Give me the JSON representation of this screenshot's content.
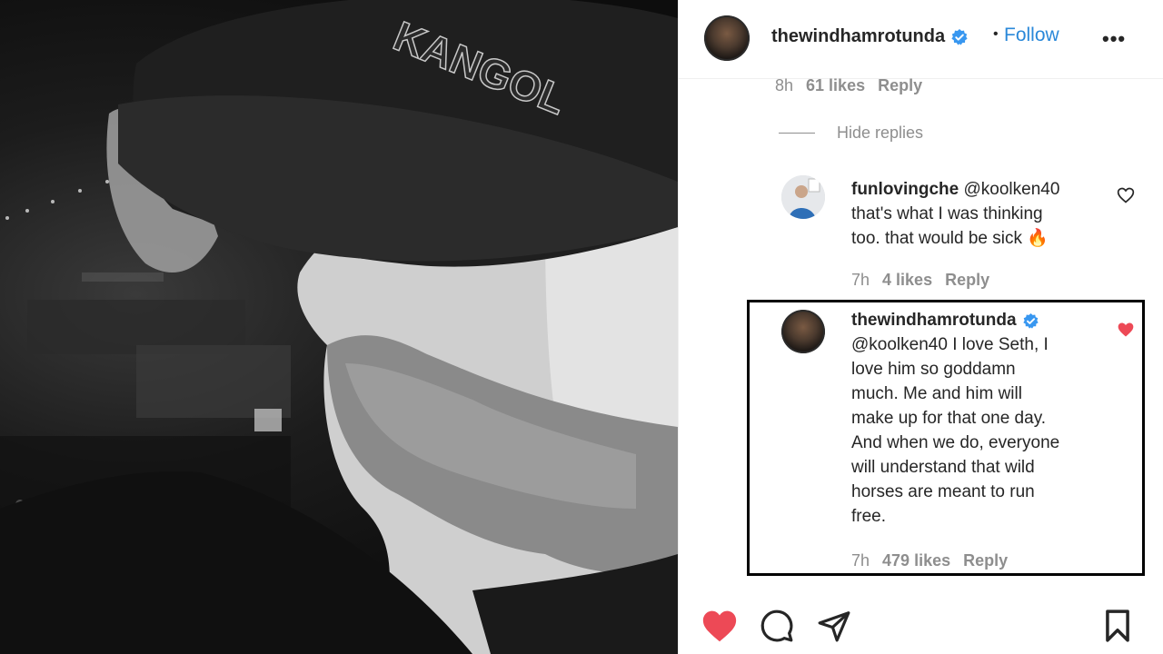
{
  "post": {
    "image_text": "KANGOL",
    "author": "thewindhamrotunda",
    "follow_label": "Follow",
    "separator": "•",
    "more_label": "•••"
  },
  "top_meta": {
    "time": "8h",
    "likes": "61 likes",
    "reply": "Reply"
  },
  "hide_replies": "Hide replies",
  "comments": [
    {
      "user": "funlovingche",
      "text_lines": [
        "@koolken40",
        "that's what I was thinking",
        "too. that would be sick 🔥"
      ],
      "time": "7h",
      "likes": "4 likes",
      "reply": "Reply",
      "liked": false
    },
    {
      "user": "thewindhamrotunda",
      "text_lines": [
        "@koolken40 I love Seth, I",
        "love him so goddamn",
        "much. Me and him will",
        "make up for that one day.",
        "And when we do, everyone",
        "will understand that wild",
        "horses are meant to run",
        "free."
      ],
      "time": "7h",
      "likes": "479 likes",
      "reply": "Reply",
      "liked": true
    }
  ],
  "icons": {
    "like": "heart-icon",
    "comment": "comment-icon",
    "share": "share-icon",
    "save": "bookmark-icon",
    "verified": "verified-badge-icon"
  },
  "colors": {
    "link": "#2a88d9",
    "verified": "#3897f0",
    "liked": "#ed4956",
    "muted": "#8e8e8e"
  }
}
